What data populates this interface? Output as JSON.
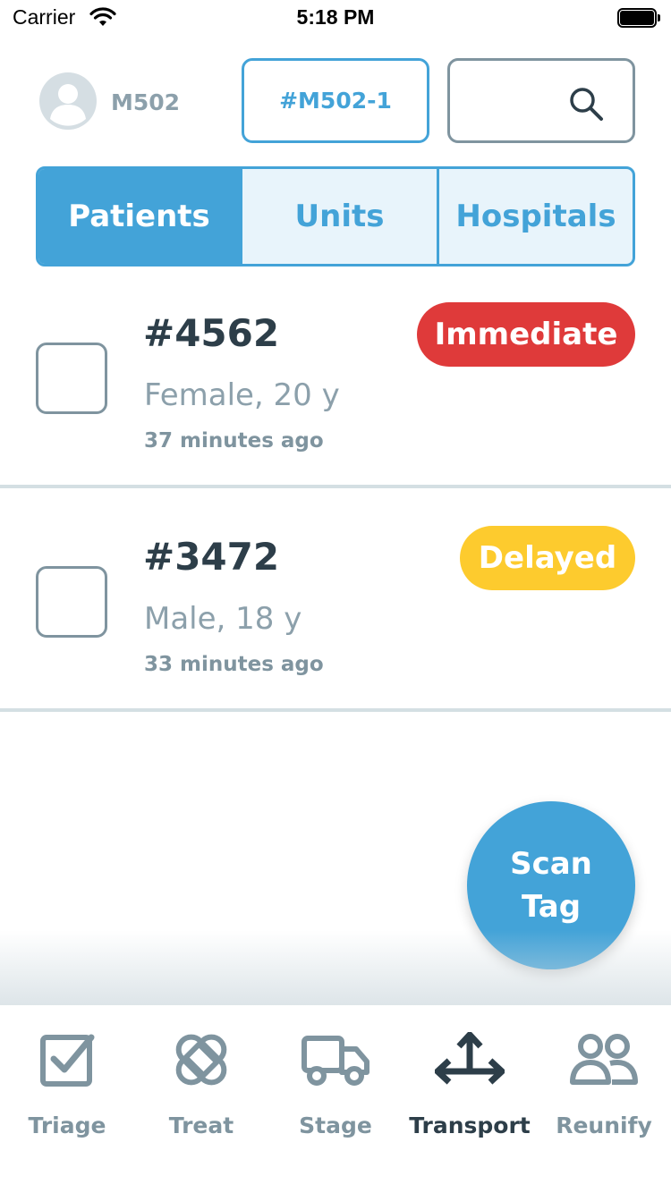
{
  "status_bar": {
    "carrier": "Carrier",
    "time": "5:18 PM"
  },
  "header": {
    "user_label": "M502",
    "unit_button_label": "#M502-1"
  },
  "tabs": [
    {
      "label": "Patients",
      "selected": true
    },
    {
      "label": "Units",
      "selected": false
    },
    {
      "label": "Hospitals",
      "selected": false
    }
  ],
  "patients": [
    {
      "id": "#4562",
      "info": "Female, 20 y",
      "time": "37 minutes ago",
      "priority": "Immediate",
      "priority_color": "#df3a3a",
      "checked": false
    },
    {
      "id": "#3472",
      "info": "Male, 18 y",
      "time": "33 minutes ago",
      "priority": "Delayed",
      "priority_color": "#fdcb2e",
      "checked": false
    }
  ],
  "scan_button": {
    "line1": "Scan",
    "line2": "Tag"
  },
  "tabbar": [
    {
      "label": "Triage",
      "icon": "checkbox-icon",
      "active": false
    },
    {
      "label": "Treat",
      "icon": "bandage-icon",
      "active": false
    },
    {
      "label": "Stage",
      "icon": "truck-icon",
      "active": false
    },
    {
      "label": "Transport",
      "icon": "move-arrows-icon",
      "active": true
    },
    {
      "label": "Reunify",
      "icon": "people-icon",
      "active": false
    }
  ],
  "colors": {
    "accent": "#43a3d8",
    "text_dark": "#2d3e49",
    "muted": "#8ca0ab",
    "divider": "#d4dfe3"
  }
}
